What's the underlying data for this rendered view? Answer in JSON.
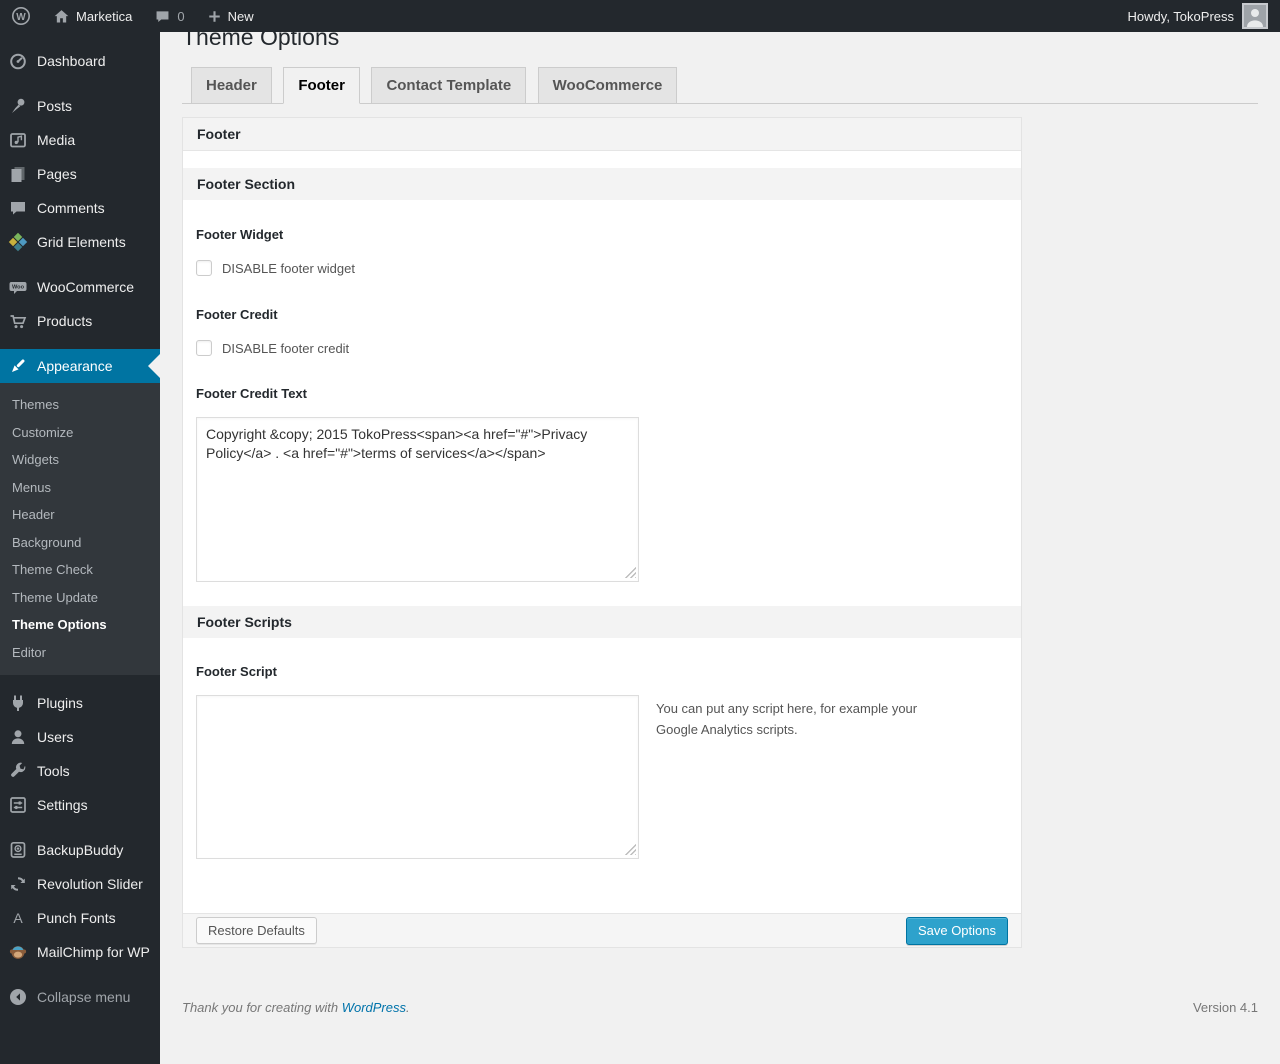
{
  "admin_bar": {
    "site_name": "Marketica",
    "comments_count": "0",
    "new_label": "New",
    "howdy": "Howdy, TokoPress"
  },
  "sidebar": {
    "items": [
      {
        "label": "Dashboard",
        "icon": "dashboard-icon"
      },
      {
        "label": "Posts",
        "icon": "pin-icon"
      },
      {
        "label": "Media",
        "icon": "media-icon"
      },
      {
        "label": "Pages",
        "icon": "pages-icon"
      },
      {
        "label": "Comments",
        "icon": "comment-icon"
      },
      {
        "label": "Grid Elements",
        "icon": "grid-icon"
      },
      {
        "label": "WooCommerce",
        "icon": "woo-badge-icon"
      },
      {
        "label": "Products",
        "icon": "cart-icon"
      },
      {
        "label": "Appearance",
        "icon": "brush-icon",
        "active": true
      },
      {
        "label": "Plugins",
        "icon": "plug-icon"
      },
      {
        "label": "Users",
        "icon": "user-icon"
      },
      {
        "label": "Tools",
        "icon": "wrench-icon"
      },
      {
        "label": "Settings",
        "icon": "sliders-icon"
      },
      {
        "label": "BackupBuddy",
        "icon": "backup-icon"
      },
      {
        "label": "Revolution Slider",
        "icon": "rotate-icon"
      },
      {
        "label": "Punch Fonts",
        "icon": "letter-a-icon"
      },
      {
        "label": "MailChimp for WP",
        "icon": "monkey-icon"
      }
    ],
    "appearance_submenu": [
      "Themes",
      "Customize",
      "Widgets",
      "Menus",
      "Header",
      "Background",
      "Theme Check",
      "Theme Update",
      "Theme Options",
      "Editor"
    ],
    "active_item": "Appearance",
    "active_subitem": "Theme Options",
    "collapse_label": "Collapse menu"
  },
  "page": {
    "title": "Theme Options",
    "tabs": [
      {
        "label": "Header",
        "active": false
      },
      {
        "label": "Footer",
        "active": true
      },
      {
        "label": "Contact Template",
        "active": false
      },
      {
        "label": "WooCommerce",
        "active": false
      }
    ]
  },
  "panel": {
    "box_title": "Footer",
    "section1": {
      "title": "Footer Section",
      "footer_widget_label": "Footer Widget",
      "footer_widget_checkbox_label": "DISABLE footer widget",
      "footer_widget_checked": false,
      "footer_credit_label": "Footer Credit",
      "footer_credit_checkbox_label": "DISABLE footer credit",
      "footer_credit_checked": false,
      "footer_credit_text_label": "Footer Credit Text",
      "footer_credit_text_value": "Copyright &copy; 2015 TokoPress<span><a href=\"#\">Privacy Policy</a> . <a href=\"#\">terms of services</a></span>"
    },
    "section2": {
      "title": "Footer Scripts",
      "footer_script_label": "Footer Script",
      "footer_script_value": "",
      "description": "You can put any script here, for example your Google Analytics scripts."
    },
    "buttons": {
      "restore": "Restore Defaults",
      "save": "Save Options"
    }
  },
  "page_footer": {
    "thanks_prefix": "Thank you for creating with ",
    "wordpress_link": "WordPress",
    "thanks_suffix": ".",
    "version": "Version 4.1"
  },
  "colors": {
    "accent": "#0074a2",
    "primary_button": "#2ea2cc",
    "link": "#0073aa",
    "dark_bg": "#23282d",
    "submenu_bg": "#32373c"
  }
}
